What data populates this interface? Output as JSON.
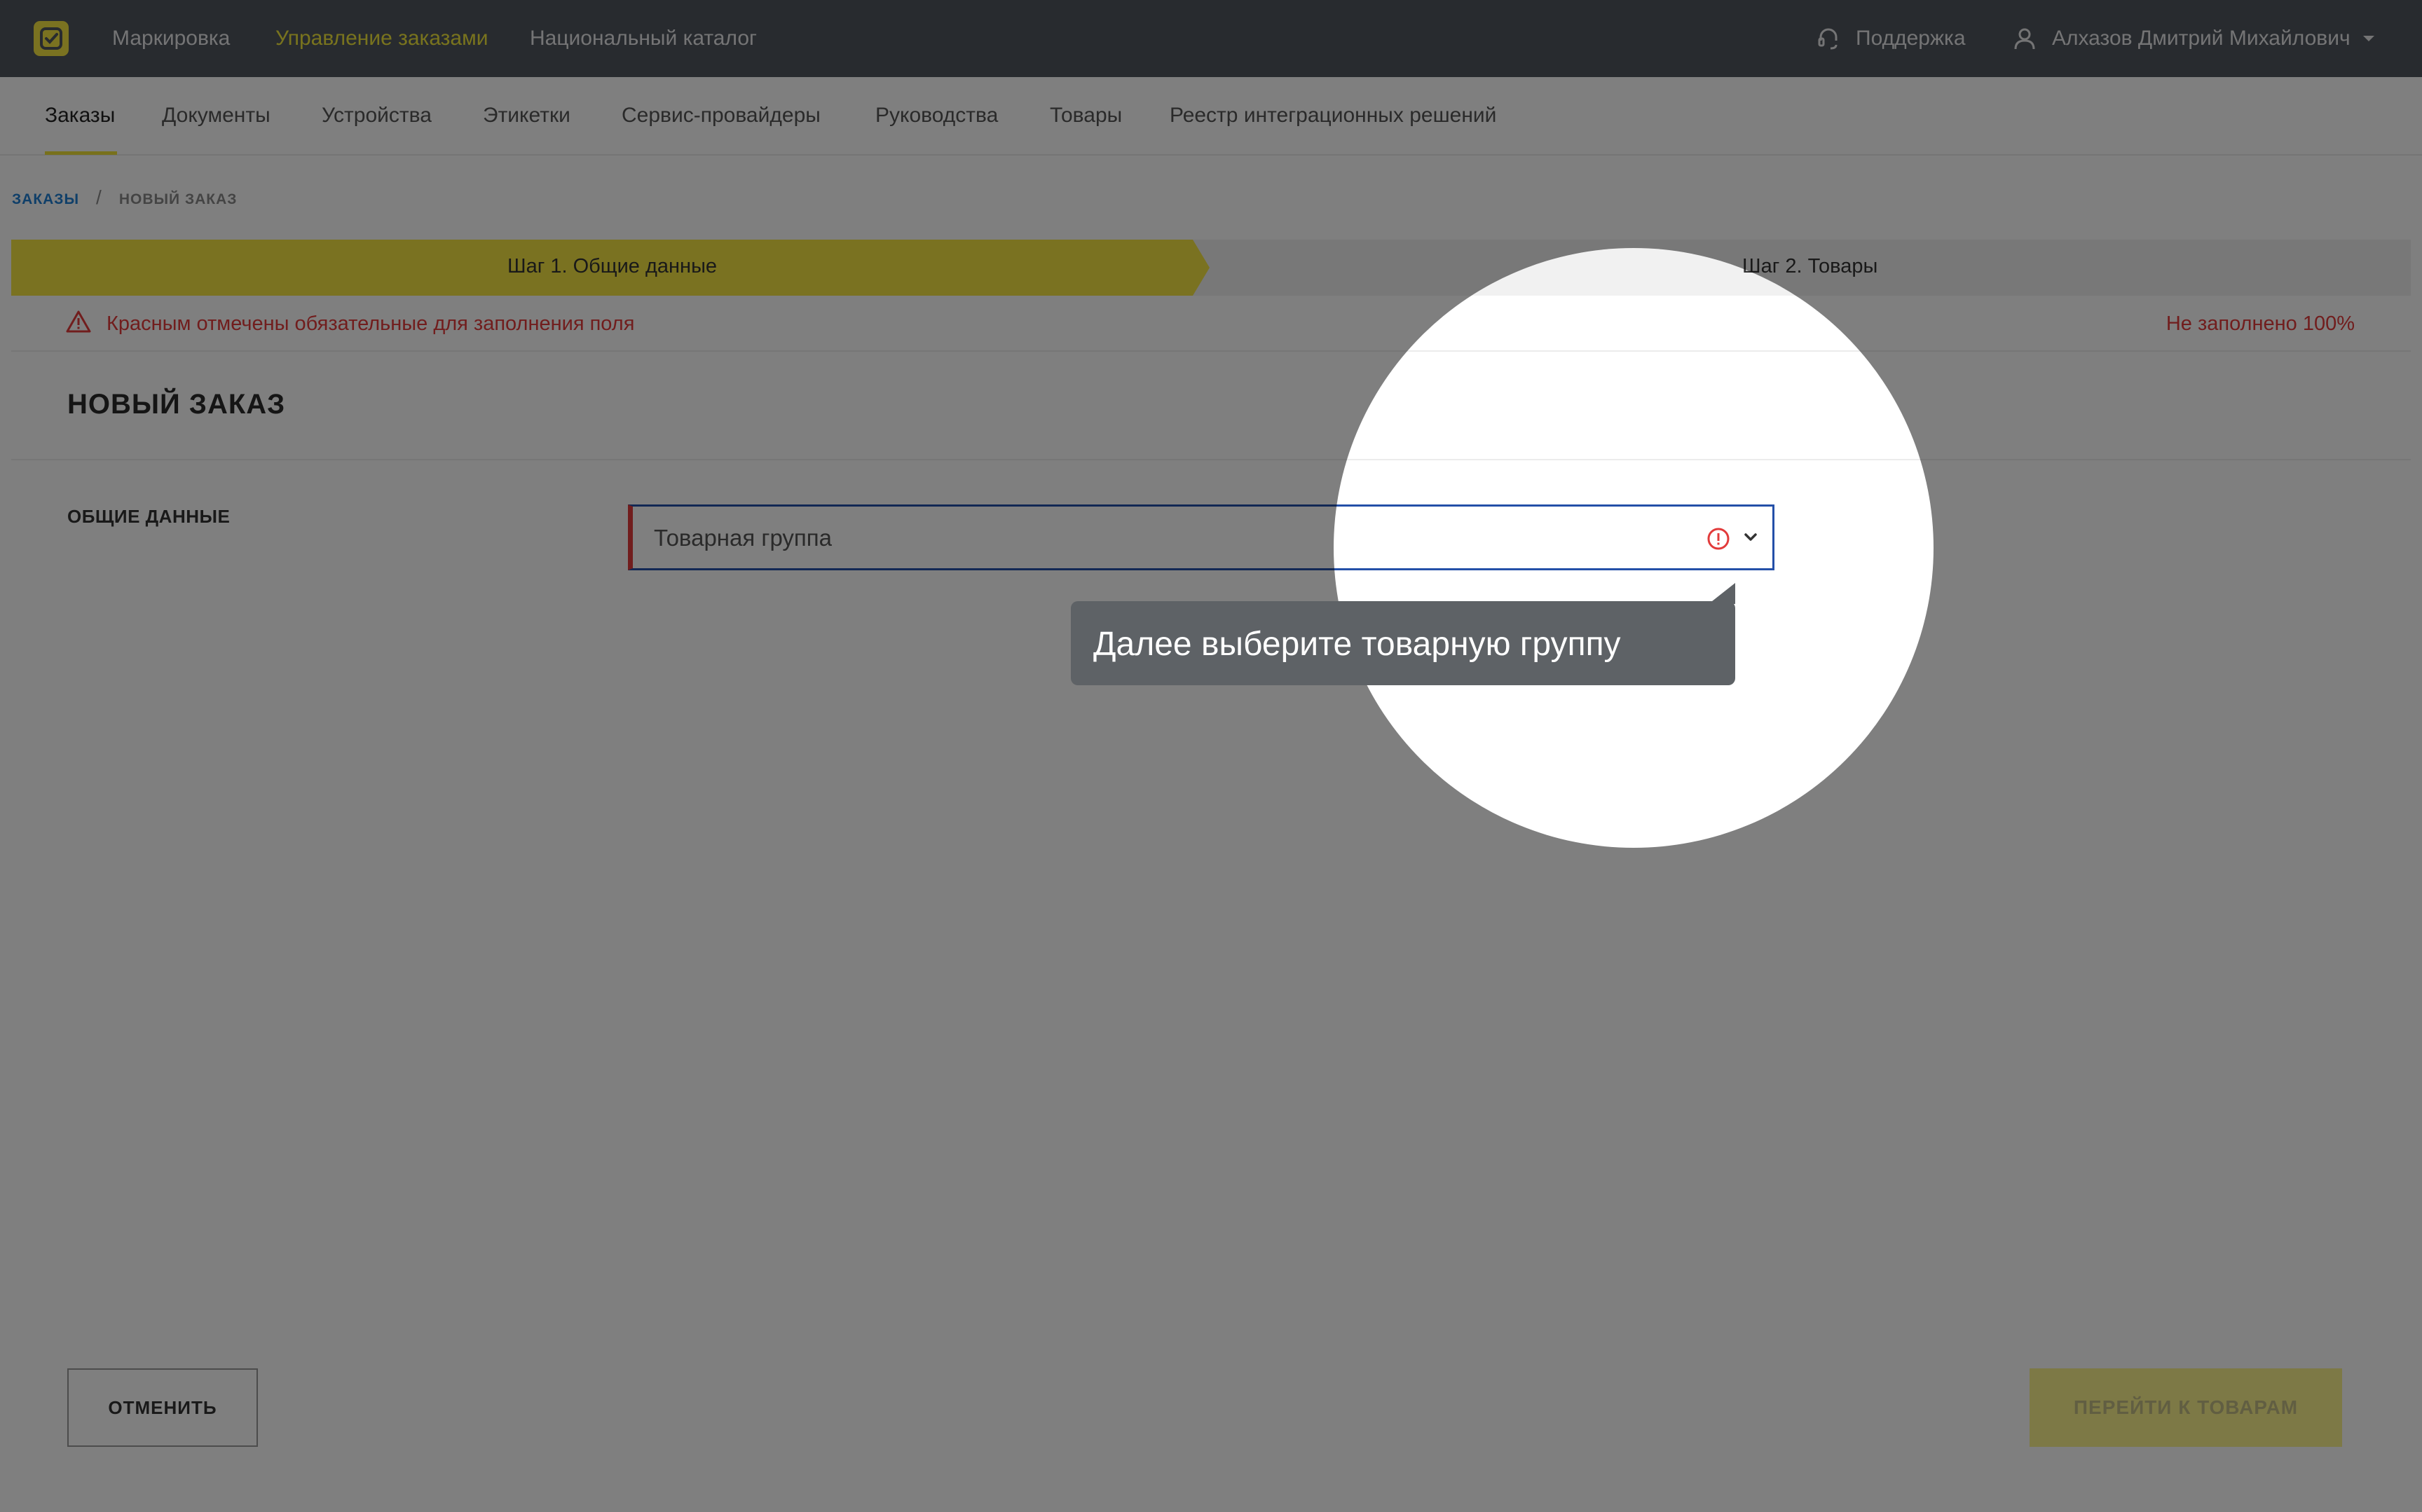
{
  "topbar": {
    "logo_icon": "checkbox-logo-icon",
    "nav": [
      {
        "label": "Маркировка",
        "active": false
      },
      {
        "label": "Управление заказами",
        "active": true
      },
      {
        "label": "Национальный каталог",
        "active": false
      }
    ],
    "support_label": "Поддержка",
    "support_icon": "headset-icon",
    "user_name": "Алхазов Дмитрий Михайлович",
    "user_icon": "user-icon"
  },
  "subnav": {
    "items": [
      {
        "label": "Заказы",
        "active": true
      },
      {
        "label": "Документы"
      },
      {
        "label": "Устройства"
      },
      {
        "label": "Этикетки"
      },
      {
        "label": "Сервис-провайдеры"
      },
      {
        "label": "Руководства"
      },
      {
        "label": "Товары"
      },
      {
        "label": "Реестр интеграционных решений"
      }
    ]
  },
  "breadcrumb": {
    "parent": "ЗАКАЗЫ",
    "separator": "/",
    "current": "НОВЫЙ ЗАКАЗ"
  },
  "steps": [
    {
      "label": "Шаг 1. Общие данные",
      "active": true
    },
    {
      "label": "Шаг 2. Товары",
      "active": false
    }
  ],
  "warning": {
    "text": "Красным отмечены обязательные для заполнения поля",
    "progress": "Не заполнено 100%"
  },
  "page_title": "НОВЫЙ ЗАКАЗ",
  "section": {
    "label": "ОБЩИЕ ДАННЫЕ",
    "product_group": {
      "placeholder": "Товарная группа",
      "value": ""
    }
  },
  "tooltip": {
    "text": "Далее выберите товарную группу"
  },
  "buttons": {
    "cancel": "ОТМЕНИТЬ",
    "next": "ПЕРЕЙТИ К ТОВАРАМ"
  },
  "colors": {
    "accent": "#f4e542",
    "topbar": "#50565e",
    "error": "#e23b3b",
    "link": "#1f7ed2",
    "dim_overlay": "rgba(0,0,0,0.5)"
  }
}
